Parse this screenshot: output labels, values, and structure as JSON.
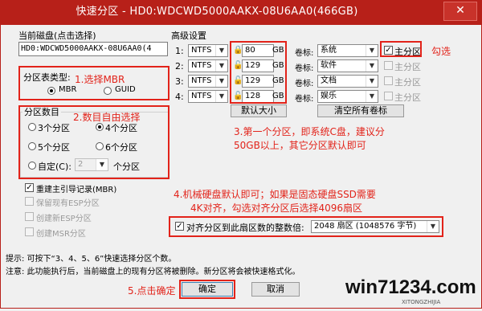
{
  "window": {
    "title": "快速分区 - HD0:WDCWD5000AAKX-08U6AA0(466GB)",
    "close": "✕"
  },
  "current_disk": {
    "label": "当前磁盘(点击选择)",
    "value": "HD0:WDCWD5000AAKX-08U6AA0(4"
  },
  "partition_table": {
    "label": "分区表类型:",
    "mbr": "MBR",
    "guid": "GUID",
    "selected": "MBR"
  },
  "partition_count": {
    "label": "分区数目",
    "options": [
      "3个分区",
      "4个分区",
      "5个分区",
      "6个分区"
    ],
    "selected": "4个分区",
    "custom_label": "自定(C):",
    "custom_value": "2",
    "custom_suffix": "个分区"
  },
  "options": [
    {
      "label": "重建主引导记录(MBR)",
      "checked": true,
      "enabled": true
    },
    {
      "label": "保留现有ESP分区",
      "checked": false,
      "enabled": false
    },
    {
      "label": "创建新ESP分区",
      "checked": false,
      "enabled": false
    },
    {
      "label": "创建MSR分区",
      "checked": false,
      "enabled": false
    }
  ],
  "advanced": {
    "label": "高级设置",
    "rows": [
      {
        "index": "1:",
        "fs": "NTFS",
        "size": "80",
        "unit": "GB",
        "vol_label": "卷标:",
        "volume": "系统",
        "primary": true,
        "primary_enabled": true
      },
      {
        "index": "2:",
        "fs": "NTFS",
        "size": "129",
        "unit": "GB",
        "vol_label": "卷标:",
        "volume": "软件",
        "primary": false,
        "primary_enabled": false
      },
      {
        "index": "3:",
        "fs": "NTFS",
        "size": "129",
        "unit": "GB",
        "vol_label": "卷标:",
        "volume": "文档",
        "primary": false,
        "primary_enabled": false
      },
      {
        "index": "4:",
        "fs": "NTFS",
        "size": "128",
        "unit": "GB",
        "vol_label": "卷标:",
        "volume": "娱乐",
        "primary": false,
        "primary_enabled": false
      }
    ],
    "primary_label": "主分区",
    "default_size_btn": "默认大小",
    "clear_labels_btn": "清空所有卷标"
  },
  "align": {
    "label": "对齐分区到此扇区数的整数倍:",
    "checked": true,
    "value": "2048 扇区 (1048576 字节)"
  },
  "hint": {
    "line1": "提示: 可按下“3、4、5、6”快速选择分区个数。",
    "line2": "注意: 此功能执行后，当前磁盘上的现有分区将被删除。新分区将会被快速格式化。"
  },
  "buttons": {
    "ok": "确定",
    "cancel": "取消"
  },
  "annotations": {
    "a1": "1.选择MBR",
    "a2": "2.数目自由选择",
    "a3a": "3.第一个分区，即系统C盘，建议分",
    "a3b": "50GB以上，其它分区默认即可",
    "a4a": "4.机械硬盘默认即可；如果是固态硬盘SSD需要",
    "a4b": "4K对齐，勾选对齐分区后选择4096扇区",
    "a5": "5.点击确定",
    "check": "勾选"
  },
  "watermark": {
    "text": "win71234.com",
    "sub": "XITONGZHIJIA"
  },
  "colors": {
    "accent": "#e2231a",
    "titlebar": "#b72019"
  }
}
